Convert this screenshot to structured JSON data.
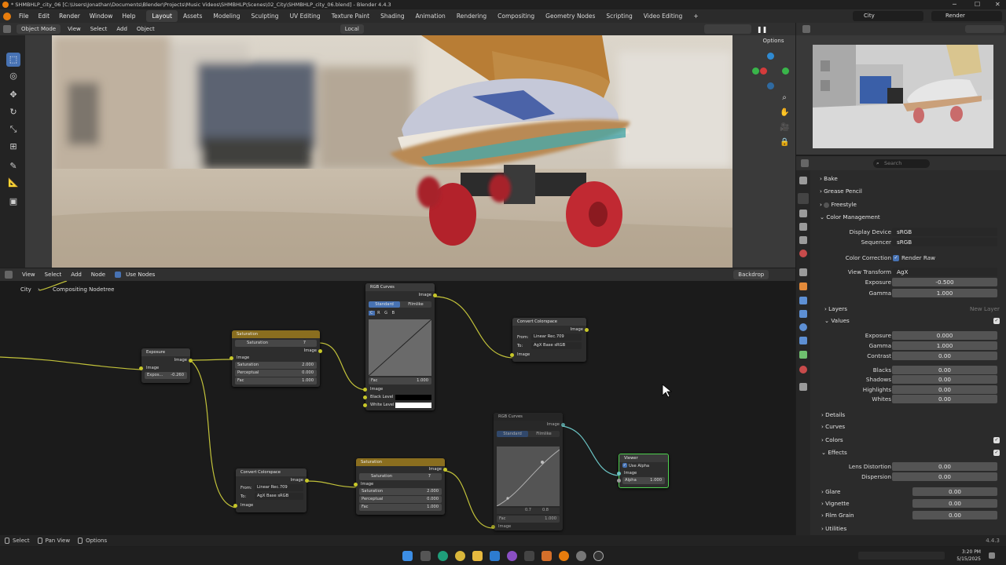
{
  "window": {
    "title": "* SHMBHLP_city_06 [C:\\Users\\Jonathan\\Documents\\Blender\\Projects\\Music Videos\\SHMBHLP\\Scenes\\02_City\\SHMBHLP_city_06.blend] - Blender 4.4.3",
    "minimize": "─",
    "maximize": "☐",
    "close": "✕"
  },
  "menu": {
    "items": [
      "File",
      "Edit",
      "Render",
      "Window",
      "Help"
    ],
    "workspaces": [
      "Layout",
      "Assets",
      "Modeling",
      "Sculpting",
      "UV Editing",
      "Texture Paint",
      "Shading",
      "Animation",
      "Rendering",
      "Compositing",
      "Geometry Nodes",
      "Scripting",
      "Video Editing"
    ],
    "add_workspace": "+",
    "scene": "City",
    "view_layer": "Render"
  },
  "viewport": {
    "mode": "Object Mode",
    "menu": [
      "View",
      "Select",
      "Add",
      "Object"
    ],
    "orientation": "Local",
    "options": "Options"
  },
  "node_editor": {
    "menu": [
      "View",
      "Select",
      "Add",
      "Node"
    ],
    "use_nodes": "Use Nodes",
    "backdrop": "Backdrop",
    "breadcrumb_scene": "City",
    "breadcrumb_tree": "Compositing Nodetree",
    "nodes": {
      "exposure": {
        "title": "Exposure",
        "out_image": "Image",
        "in_image": "Image",
        "expo_label": "Expos...",
        "expo_val": "-0.260"
      },
      "saturation1": {
        "title": "Saturation",
        "dd": "Saturation",
        "users": "7",
        "out_image": "Image",
        "in_image": "Image",
        "sat_label": "Saturation",
        "sat_val": "2.000",
        "perc_label": "Perceptual",
        "perc_val": "0.000",
        "fac_label": "Fac",
        "fac_val": "1.000"
      },
      "rgb1": {
        "title": "RGB Curves",
        "out_image": "Image",
        "tab1": "Standard",
        "tab2": "Filmlike",
        "channels": [
          "C",
          "R",
          "G",
          "B"
        ],
        "fac_label": "Fac",
        "fac_val": "1.000",
        "in_image": "Image",
        "black": "Black Level",
        "white": "White Level"
      },
      "convert1": {
        "title": "Convert Colorspace",
        "out_image": "Image",
        "from_label": "From:",
        "from_val": "Linear Rec.709",
        "to_label": "To:",
        "to_val": "AgX Base sRGB",
        "in_image": "Image"
      },
      "convert2": {
        "title": "Convert Colorspace",
        "out_image": "Image",
        "from_label": "From:",
        "from_val": "Linear Rec.709",
        "to_label": "To:",
        "to_val": "AgX Base sRGB",
        "in_image": "Image"
      },
      "saturation2": {
        "title": "Saturation",
        "dd": "Saturation",
        "users": "7",
        "out_image": "Image",
        "in_image": "Image",
        "sat_label": "Saturation",
        "sat_val": "2.000",
        "perc_label": "Perceptual",
        "perc_val": "0.000",
        "fac_label": "Fac",
        "fac_val": "1.000"
      },
      "rgb2": {
        "title": "RGB Curves",
        "out_image": "Image",
        "tab1": "Standard",
        "tab2": "Filmlike",
        "pt_x": "0.7",
        "pt_y": "0.8",
        "fac_label": "Fac",
        "fac_val": "1.000",
        "in_image": "Image"
      },
      "viewer": {
        "title": "Viewer",
        "use_alpha": "Use Alpha",
        "in_image": "Image",
        "alpha_label": "Alpha",
        "alpha_val": "1.000"
      }
    }
  },
  "properties": {
    "search": "Search",
    "sections": {
      "bake": "Bake",
      "grease_pencil": "Grease Pencil",
      "freestyle": "Freestyle",
      "color_management": "Color Management",
      "layers": "Layers",
      "new_layer": "New Layer",
      "values": "Values",
      "details": "Details",
      "curves": "Curves",
      "colors": "Colors",
      "effects": "Effects",
      "glare": "Glare",
      "vignette": "Vignette",
      "film_grain": "Film Grain",
      "utilities": "Utilities"
    },
    "display_device_label": "Display Device",
    "display_device": "sRGB",
    "sequencer_label": "Sequencer",
    "sequencer": "sRGB",
    "color_correction_label": "Color Correction",
    "render_raw": "Render Raw",
    "view_transform_label": "View Transform",
    "view_transform": "AgX",
    "exposure_label": "Exposure",
    "exposure": "-0.500",
    "gamma_label": "Gamma",
    "gamma": "1.000",
    "values": {
      "exposure_label": "Exposure",
      "exposure": "0.000",
      "gamma_label": "Gamma",
      "gamma": "1.000",
      "contrast_label": "Contrast",
      "contrast": "0.00",
      "blacks_label": "Blacks",
      "blacks": "0.00",
      "shadows_label": "Shadows",
      "shadows": "0.00",
      "highlights_label": "Highlights",
      "highlights": "0.00",
      "whites_label": "Whites",
      "whites": "0.00"
    },
    "effects": {
      "lens_label": "Lens Distortion",
      "lens": "0.00",
      "dispersion_label": "Dispersion",
      "dispersion": "0.00",
      "glare": "0.00",
      "vignette": "0.00",
      "film_grain": "0.00"
    }
  },
  "status": {
    "select": "Select",
    "pan": "Pan View",
    "options": "Options",
    "version": "4.4.3"
  },
  "taskbar": {
    "time": "3:20 PM",
    "date": "5/15/2025"
  },
  "colors": {
    "accent": "#4772b3",
    "socket_yellow": "#c7c729",
    "socket_gray": "#9a9a9a",
    "node_header_gold": "#8a6e1f",
    "viewer_border": "#4fd14f"
  }
}
